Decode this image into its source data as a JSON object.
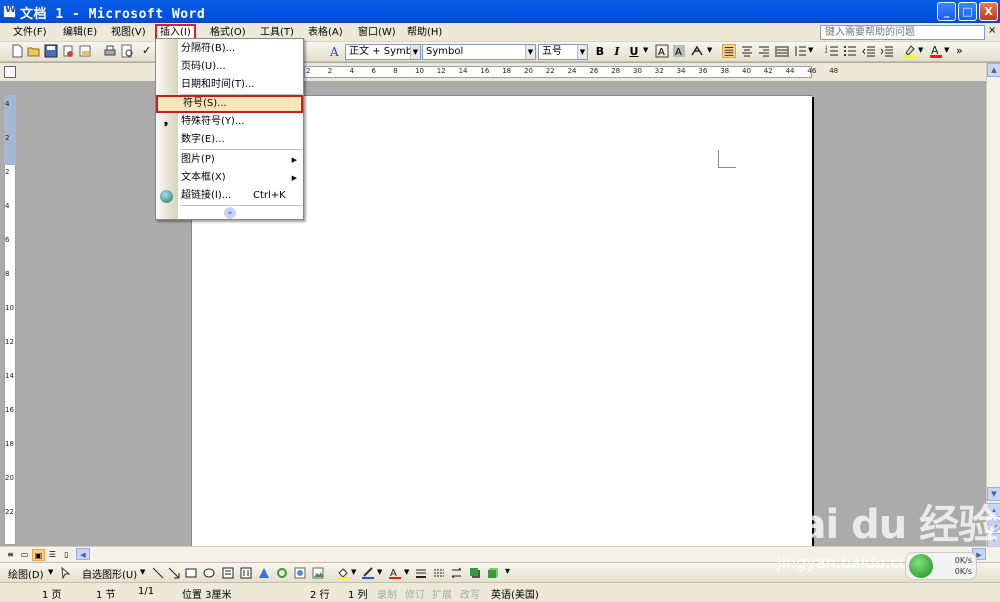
{
  "window": {
    "title": "文档 1 - Microsoft Word",
    "min": "_",
    "max": "□",
    "close": "X"
  },
  "menu": {
    "file": "文件(F)",
    "edit": "编辑(E)",
    "view": "视图(V)",
    "insert": "插入(I)",
    "format": "格式(O)",
    "tools": "工具(T)",
    "table": "表格(A)",
    "window": "窗口(W)",
    "help": "帮助(H)",
    "help_placeholder": "键入需要帮助的问题",
    "help_close": "×"
  },
  "toolbar": {
    "style": "正文 + Symbol",
    "font": "Symbol",
    "size": "五号",
    "bold": "B",
    "italic": "I",
    "underline": "U"
  },
  "ruler": {
    "h_ticks": [
      "2",
      "2",
      "4",
      "6",
      "8",
      "10",
      "12",
      "14",
      "16",
      "18",
      "20",
      "22",
      "24",
      "26",
      "28",
      "30",
      "32",
      "34",
      "36",
      "38",
      "40",
      "42",
      "44",
      "46",
      "48"
    ],
    "v_ticks": [
      "4",
      "2",
      "2",
      "4",
      "6",
      "8",
      "10",
      "12",
      "14",
      "16",
      "18",
      "20",
      "22"
    ]
  },
  "insert_menu": {
    "items": [
      {
        "label": "分隔符(B)...",
        "shortcut": "",
        "submenu": false
      },
      {
        "label": "页码(U)...",
        "shortcut": "",
        "submenu": false
      },
      {
        "label": "日期和时间(T)...",
        "shortcut": "",
        "submenu": false
      },
      {
        "label": "符号(S)...",
        "shortcut": "",
        "submenu": false
      },
      {
        "label": "特殊符号(Y)...",
        "shortcut": "",
        "submenu": false
      },
      {
        "label": "数字(E)...",
        "shortcut": "",
        "submenu": false
      },
      {
        "label": "图片(P)",
        "shortcut": "",
        "submenu": true
      },
      {
        "label": "文本框(X)",
        "shortcut": "",
        "submenu": true
      },
      {
        "label": "超链接(I)...",
        "shortcut": "Ctrl+K",
        "submenu": false
      }
    ],
    "more": "»"
  },
  "draw_toolbar": {
    "draw": "绘图(D)",
    "autoshapes": "自选图形(U)"
  },
  "status": {
    "page": "1 页",
    "section": "1 节",
    "page_of": "1/1",
    "position": "位置 3厘米",
    "line": "2 行",
    "col": "1 列",
    "rec": "录制",
    "trk": "修订",
    "ext": "扩展",
    "ovr": "改写",
    "lang": "英语(美国)"
  },
  "watermark": {
    "brand": "Bai du 经验",
    "url": "jingyan.baidu.com"
  },
  "net": {
    "up": "0K/s",
    "down": "0K/s"
  }
}
